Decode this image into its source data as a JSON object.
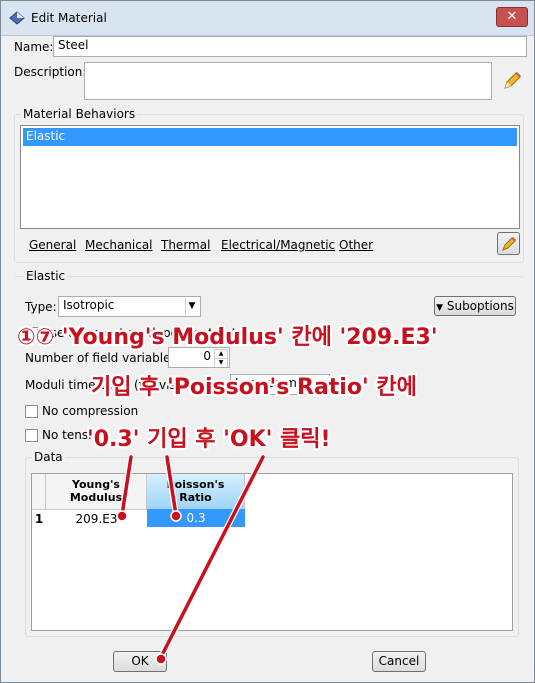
{
  "window": {
    "title": "Edit Material",
    "close_glyph": "✕"
  },
  "name": {
    "label": "Name:",
    "value": "Steel"
  },
  "description": {
    "label": "Description:",
    "value": ""
  },
  "behaviors": {
    "group_title": "Material Behaviors",
    "items": [
      "Elastic"
    ]
  },
  "menus": [
    "General",
    "Mechanical",
    "Thermal",
    "Electrical/Magnetic",
    "Other"
  ],
  "elastic": {
    "group_title": "Elastic",
    "type_label": "Type:",
    "type_value": "Isotropic",
    "suboptions_label": "Suboptions",
    "use_temp_label": "Use temperature-dependent data",
    "field_vars_label": "Number of field variables:",
    "field_vars_value": "0",
    "moduli_label": "Moduli time scale (for viscoelasticity):",
    "moduli_value": "Long-term",
    "no_compression_label": "No compression",
    "no_tension_label": "No tension"
  },
  "data": {
    "group_title": "Data",
    "columns": [
      "Young's\nModulus",
      "Poisson's\nRatio"
    ],
    "rows": [
      {
        "index": "1",
        "youngs": "209.E3",
        "poisson": "0.3"
      }
    ]
  },
  "buttons": {
    "ok": "OK",
    "cancel": "Cancel"
  },
  "annotation": {
    "line1": "①⑦ 'Young's Modulus' 칸에 '209.E3'",
    "line2": "기입 후 'Poisson's Ratio' 칸에",
    "line3": "'0.3' 기입 후 'OK' 클릭!",
    "color": "#c8101e"
  },
  "colors": {
    "selection": "#3399ff",
    "title_bar": "#d9e4f1"
  }
}
